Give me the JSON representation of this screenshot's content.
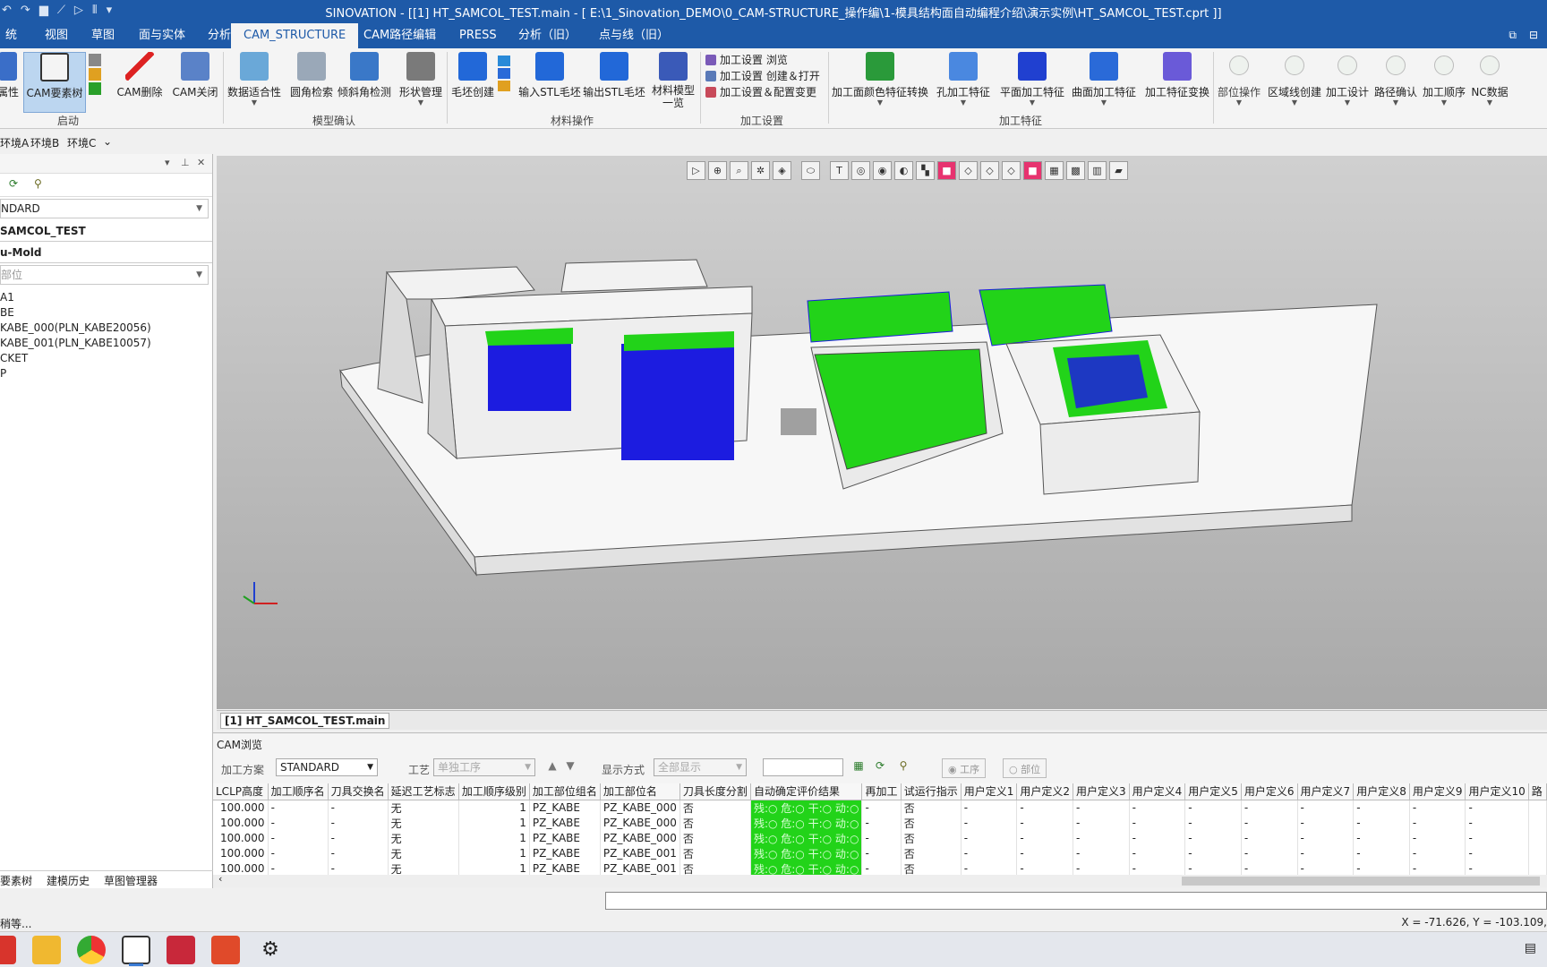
{
  "window": {
    "title": "SINOVATION - [[1] HT_SAMCOL_TEST.main - [ E:\\1_Sinovation_DEMO\\0_CAM-STRUCTURE_操作编\\1-模具结构面自动编程介绍\\演示实例\\HT_SAMCOL_TEST.cprt ]]"
  },
  "menu": {
    "tabs": [
      "统",
      "视图",
      "草图",
      "面与实体",
      "分析",
      "CAM_STRUCTURE",
      "CAM路径编辑",
      "PRESS",
      "分析（旧）",
      "点与线（旧）"
    ],
    "active": "CAM_STRUCTURE"
  },
  "ribbon": {
    "buttons": {
      "attr": "属性",
      "cam_tree": "CAM要素树",
      "cam_delete": "CAM删除",
      "cam_close": "CAM关闭",
      "data_fit": "数据适合性",
      "fillet_search": "圆角检索",
      "tilt_detect": "倾斜角检测",
      "shape_mgmt": "形状管理",
      "blank_create": "毛坯创建",
      "import_stl": "输入STL毛坯",
      "export_stl": "输出STL毛坯",
      "material_list": "材料模型一览",
      "color_feature": "加工面颜色特征转换",
      "hole_feature": "孔加工特征",
      "plane_feature": "平面加工特征",
      "surface_feature": "曲面加工特征",
      "feature_convert": "加工特征变换",
      "part_op": "部位操作",
      "region_line": "区域线创建",
      "mach_design": "加工设计",
      "path_confirm": "路径确认",
      "mach_order": "加工顺序",
      "nc_data": "NC数据"
    },
    "settings_list": [
      "加工设置 浏览",
      "加工设置 创建＆打开",
      "加工设置＆配置变更"
    ],
    "groups": {
      "start": "启动",
      "model_confirm": "模型确认",
      "material_op": "材料操作",
      "mach_settings": "加工设置",
      "mach_feature": "加工特征"
    }
  },
  "env": [
    "环境A",
    "环境B",
    "环境C"
  ],
  "left_panel": {
    "combo_standard": "NDARD",
    "part_name": "SAMCOL_TEST",
    "mold": "u-Mold",
    "part_placeholder": "部位",
    "tree": [
      "A1",
      "BE",
      "KABE_000(PLN_KABE20056)",
      "KABE_001(PLN_KABE10057)",
      "CKET",
      "P"
    ],
    "bottom_tabs": [
      "要素树",
      "建模历史",
      "草图管理器"
    ]
  },
  "viewport": {
    "doc_tab": "[1] HT_SAMCOL_TEST.main"
  },
  "cam_browse": {
    "title": "CAM浏览",
    "plan_label": "加工方案",
    "plan_value": "STANDARD",
    "process_label": "工艺",
    "process_value": "单独工序",
    "display_label": "显示方式",
    "display_value": "全部显示",
    "radio_process": "工序",
    "radio_part": "部位",
    "columns": [
      "LCLP高度",
      "加工顺序名",
      "刀具交换名",
      "延迟工艺标志",
      "加工顺序级别",
      "加工部位组名",
      "加工部位名",
      "刀具长度分割",
      "自动确定评价结果",
      "再加工",
      "试运行指示",
      "用户定义1",
      "用户定义2",
      "用户定义3",
      "用户定义4",
      "用户定义5",
      "用户定义6",
      "用户定义7",
      "用户定义8",
      "用户定义9",
      "用户定义10",
      "路"
    ],
    "rows": [
      [
        "100.000",
        "-",
        "-",
        "无",
        "1",
        "PZ_KABE",
        "PZ_KABE_000",
        "否",
        "残:○ 危:○ 干:○ 动:○",
        "-",
        "否",
        "-",
        "-",
        "-",
        "-",
        "-",
        "-",
        "-",
        "-",
        "-",
        "-",
        ""
      ],
      [
        "100.000",
        "-",
        "-",
        "无",
        "1",
        "PZ_KABE",
        "PZ_KABE_000",
        "否",
        "残:○ 危:○ 干:○ 动:○",
        "-",
        "否",
        "-",
        "-",
        "-",
        "-",
        "-",
        "-",
        "-",
        "-",
        "-",
        "-",
        ""
      ],
      [
        "100.000",
        "-",
        "-",
        "无",
        "1",
        "PZ_KABE",
        "PZ_KABE_000",
        "否",
        "残:○ 危:○ 干:○ 动:○",
        "-",
        "否",
        "-",
        "-",
        "-",
        "-",
        "-",
        "-",
        "-",
        "-",
        "-",
        "-",
        ""
      ],
      [
        "100.000",
        "-",
        "-",
        "无",
        "1",
        "PZ_KABE",
        "PZ_KABE_001",
        "否",
        "残:○ 危:○ 干:○ 动:○",
        "-",
        "否",
        "-",
        "-",
        "-",
        "-",
        "-",
        "-",
        "-",
        "-",
        "-",
        "-",
        ""
      ],
      [
        "100.000",
        "-",
        "-",
        "无",
        "1",
        "PZ_KABE",
        "PZ_KABE_001",
        "否",
        "残:○ 危:○ 干:○ 动:○",
        "-",
        "否",
        "-",
        "-",
        "-",
        "-",
        "-",
        "-",
        "-",
        "-",
        "-",
        "-",
        ""
      ]
    ]
  },
  "status": {
    "left": "稍等...",
    "coords": "X = -71.626, Y = -103.109,"
  },
  "colors": {
    "accent": "#1e5aa8",
    "feature_green": "#22d319",
    "toolpath_blue": "#1c1ce0"
  }
}
